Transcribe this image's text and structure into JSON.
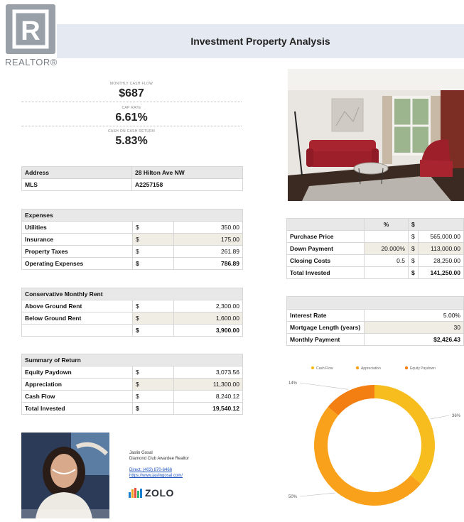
{
  "brand": {
    "realtor_word": "REALTOR®",
    "realtor_letter": "R"
  },
  "header": {
    "title": "Investment Property Analysis"
  },
  "kpis": [
    {
      "label": "MONTHLY CASH FLOW",
      "value": "$687"
    },
    {
      "label": "CAP RATE",
      "value": "6.61%"
    },
    {
      "label": "CASH ON CASH RETURN",
      "value": "5.83%"
    }
  ],
  "property": {
    "rows": [
      {
        "label": "Address",
        "value": "28 Hilton Ave NW"
      },
      {
        "label": "MLS",
        "value": "A2257158"
      }
    ]
  },
  "expenses": {
    "title": "Expenses",
    "rows": [
      {
        "label": "Utilities",
        "cur": "$",
        "value": "350.00"
      },
      {
        "label": "Insurance",
        "cur": "$",
        "value": "175.00"
      },
      {
        "label": "Property Taxes",
        "cur": "$",
        "value": "261.89"
      },
      {
        "label": "Operating Expenses",
        "cur": "$",
        "value": "786.89"
      }
    ]
  },
  "rent": {
    "title": "Conservative Monthly Rent",
    "rows": [
      {
        "label": "Above Ground Rent",
        "cur": "$",
        "value": "2,300.00"
      },
      {
        "label": "Below Ground Rent",
        "cur": "$",
        "value": "1,600.00"
      },
      {
        "label": "",
        "cur": "$",
        "value": "3,900.00"
      }
    ]
  },
  "summary": {
    "title": "Summary of Return",
    "rows": [
      {
        "label": "Equity Paydown",
        "cur": "$",
        "value": "3,073.56"
      },
      {
        "label": "Appreciation",
        "cur": "$",
        "value": "11,300.00"
      },
      {
        "label": "Cash Flow",
        "cur": "$",
        "value": "8,240.12"
      },
      {
        "label": "Total Invested",
        "cur": "$",
        "value": "19,540.12"
      }
    ]
  },
  "purchase": {
    "headers": {
      "pct": "%",
      "dollar": "$"
    },
    "rows": [
      {
        "label": "Purchase Price",
        "pct": "",
        "cur": "$",
        "value": "565,000.00"
      },
      {
        "label": "Down Payment",
        "pct": "20.000%",
        "cur": "$",
        "value": "113,000.00"
      },
      {
        "label": "Closing Costs",
        "pct": "0.5",
        "cur": "$",
        "value": "28,250.00"
      },
      {
        "label": "Total Invested",
        "pct": "",
        "cur": "$",
        "value": "141,250.00"
      }
    ]
  },
  "mortgage": {
    "rows": [
      {
        "label": "Interest Rate",
        "value": "5.00%"
      },
      {
        "label": "Mortgage Length (years)",
        "value": "30"
      },
      {
        "label": "Monthly Payment",
        "value": "$2,426.43"
      }
    ]
  },
  "agent": {
    "name": "Jaslin Gosal",
    "title": "Diamond Club Awardee Realtor",
    "phone": "Direct: (403) 870-6466",
    "website": "https://www.jaslingosal.com/",
    "brokerage": "ZOLO"
  },
  "colors": {
    "cash_flow": "#f7bc1e",
    "appreciation": "#f9a11b",
    "equity_paydown": "#f37f12",
    "header_bg": "#e5e9f1"
  },
  "chart_data": {
    "type": "pie",
    "legend_placement": "top",
    "labels": [
      "Cash Flow",
      "Appreciation",
      "Equity Paydown"
    ],
    "values": [
      36,
      50,
      14
    ],
    "value_labels": [
      "36%",
      "50%",
      "14%"
    ]
  }
}
